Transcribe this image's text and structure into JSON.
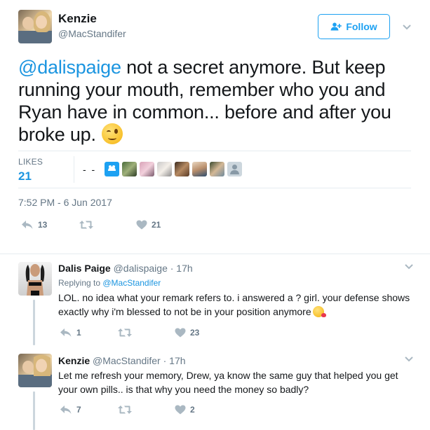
{
  "tweet": {
    "author_name": "Kenzie",
    "author_handle": "@MacStandifer",
    "follow_label": "Follow",
    "mention": "@dalispaige",
    "text": " not a secret anymore. But keep running your mouth, remember who you and Ryan have in common... before and after you broke up.",
    "emoji": "winking-face",
    "likes_label": "LIKES",
    "likes_count": "21",
    "likers_dashes": "- -",
    "likers": [
      "blue-cat-avatar",
      "avatar-2",
      "avatar-3",
      "avatar-4",
      "avatar-5",
      "avatar-6",
      "default-avatar"
    ],
    "timestamp": "7:52 PM - 6 Jun 2017",
    "replies": "13",
    "retweets": "",
    "likes": "21"
  },
  "replies": [
    {
      "name": "Dalis Paige",
      "handle": "@dalispaige",
      "time": " · 17h",
      "replying_prefix": "Replying to ",
      "replying_to": "@MacStandifer",
      "text": "LOL. no idea what your remark refers to. i answered a ? girl. your defense shows exactly why i'm blessed to not be in your position anymore",
      "emoji": "face-blowing-kiss",
      "reply_count": "1",
      "retweet_count": "",
      "like_count": "23"
    },
    {
      "name": "Kenzie",
      "handle": "@MacStandifer",
      "time": " · 17h",
      "text": "Let me refresh your memory, Drew, ya know the same guy that helped you get your own pills.. is that why you need the money so badly?",
      "reply_count": "7",
      "retweet_count": "",
      "like_count": "2"
    }
  ],
  "colors": {
    "accent": "#1da1f2",
    "link": "#1b95e0",
    "muted": "#657786",
    "divider": "#e6ecf0"
  }
}
